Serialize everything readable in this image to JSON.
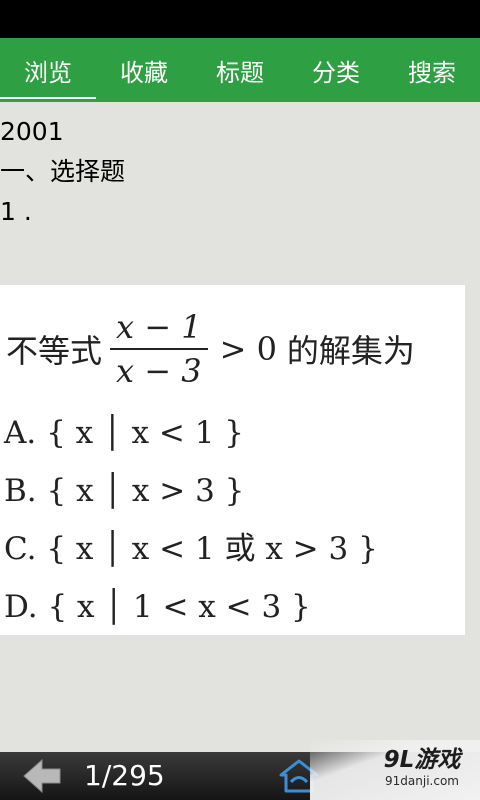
{
  "tabs": [
    {
      "label": "浏览"
    },
    {
      "label": "收藏"
    },
    {
      "label": "标题"
    },
    {
      "label": "分类"
    },
    {
      "label": "搜索"
    }
  ],
  "active_tab": "浏览",
  "question": {
    "year": "2001",
    "section": "一、选择题",
    "number": "1 ."
  },
  "question_image": {
    "stem_before": "不等式",
    "numerator": "x − 1",
    "denominator": "x − 3",
    "stem_after_op": "> 0",
    "stem_end": "的解集为",
    "options": [
      "A. { x │ x < 1 }",
      "B. { x │ x > 3 }",
      "C. { x │ x < 1 或 x > 3 }",
      "D. { x │ 1 < x < 3 }"
    ]
  },
  "pager": {
    "page": "1/295"
  },
  "icons": {
    "back": "back-arrow-icon",
    "home": "home-icon"
  },
  "watermark": {
    "logo": "9L游戏",
    "url": "91danji.com"
  },
  "colors": {
    "tab_bar": "#2f9f43",
    "background": "#e2e2de",
    "status_bar": "#000000"
  }
}
